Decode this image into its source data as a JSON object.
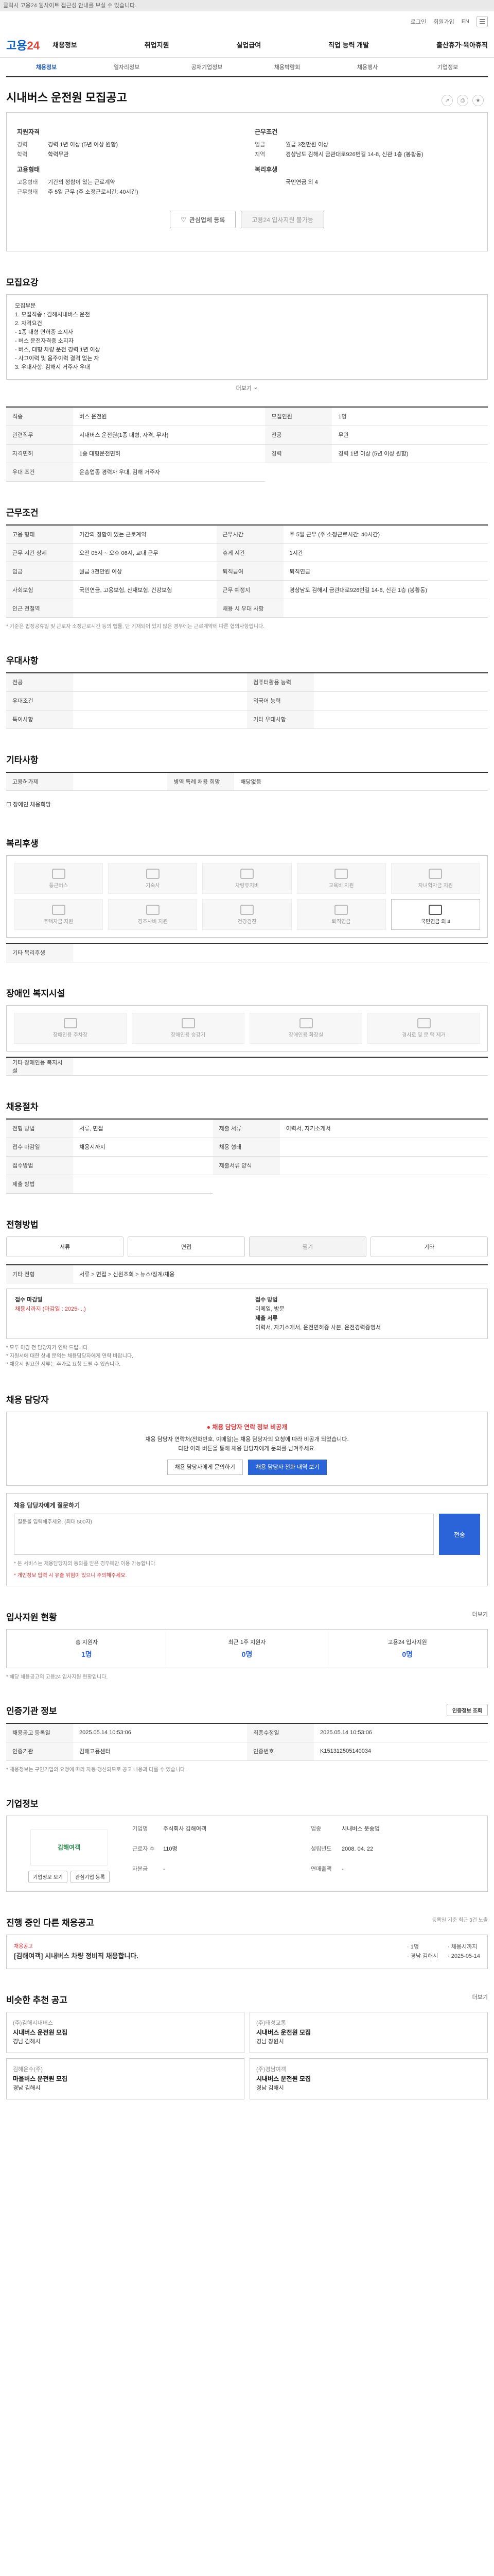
{
  "topnotice": "클릭시 고용24 웹사이트 접근성 안내를 보실 수 있습니다.",
  "util": {
    "login": "로그인",
    "join": "회원가입",
    "langs": "EN"
  },
  "logo": {
    "a": "고용",
    "b": "24"
  },
  "gnb": [
    "채용정보",
    "취업지원",
    "실업급여",
    "직업 능력 개발",
    "출산휴가·육아휴직"
  ],
  "subnav": [
    "채용정보",
    "일자리정보",
    "공채기업정보",
    "채용박람회",
    "채용행사",
    "기업정보"
  ],
  "title": "시내버스 운전원 모집공고",
  "summary": {
    "left_title": "지원자격",
    "left": [
      [
        "경력",
        "경력 1년 이상 (5년 이상 원함)"
      ],
      [
        "학력",
        "학력무관"
      ]
    ],
    "left2_title": "고용형태",
    "left2": [
      [
        "고용형태",
        "기간의 정함이 있는 근로계약"
      ],
      [
        "근무형태",
        "주 5일 근무 (주 소정근로시간: 40시간)"
      ]
    ],
    "right_title": "근무조건",
    "right": [
      [
        "임금",
        "월급 3천만원 이상"
      ],
      [
        "지역",
        "경상남도 김해시 금관대로926번길 14-8, 신관 1층 (봉황동)"
      ]
    ],
    "right2_title": "복리후생",
    "right2": [
      [
        "",
        "국민연금 외 4"
      ]
    ],
    "btn1": "관심업체 등록",
    "btn2": "고용24 입사지원 불가능"
  },
  "duty": {
    "h": "모집요강",
    "txt": "모집부문\n1. 모집직종 : 김해시내버스 운전\n2. 자격요건\n - 1종 대형 면허증 소지자\n - 버스 운전자격증 소지자\n - 버스, 대형 차량 운전 경력 1년 이상\n - 사고이력 및 음주이력 결격 없는 자\n3. 우대사항: 김해시 거주자 우대",
    "more": "더보기"
  },
  "apply": {
    "rows": [
      [
        "직종",
        "버스 운전원"
      ],
      [
        "모집인원",
        "1명"
      ],
      [
        "관련직무",
        "시내버스 운전원(1종 대형, 자격, 무사)"
      ],
      [
        "전공",
        "무관"
      ],
      [
        "자격면허",
        "1종 대형운전면허"
      ],
      [
        "경력",
        "경력 1년 이상 (5년 이상 원함)"
      ],
      [
        "우대 조건",
        "운송업종 경력자 우대, 김해 거주자"
      ]
    ],
    "right_labels": [
      "모집 직종 코드",
      "학력",
      "우대자격",
      "외국어"
    ],
    "right_values": [
      "",
      "학력무관",
      "",
      ""
    ]
  },
  "work": {
    "h": "근무조건",
    "rows": [
      [
        "고용 형태",
        "기간의 정함이 있는 근로계약"
      ],
      [
        "근무시간",
        "주 5일 근무 (주 소정근로시간: 40시간)"
      ],
      [
        "근무 시간 상세",
        "오전 05시 ~ 오후 06시, 교대 근무"
      ],
      [
        "휴게 시간",
        "1시간"
      ],
      [
        "임금",
        "월급 3천만원 이상"
      ],
      [
        "퇴직급여",
        "퇴직연금"
      ],
      [
        "사회보험",
        "국민연금, 고용보험, 산재보험, 건강보험"
      ],
      [
        "근무 예정지",
        "경상남도 김해시 금관대로926번길 14-8, 신관 1층 (봉황동)"
      ],
      [
        "인근 전철역",
        ""
      ],
      [
        "채용 시 우대 사항",
        ""
      ]
    ],
    "map": "지도 보기",
    "note": "* 기준은 법정공휴일 및 근로자 소정근로시간 등의 법률, 단 기재되어 있지 않은 경우에는 근로계약에 따른 협의사항입니다."
  },
  "preference": {
    "h": "우대사항",
    "rows": [
      [
        "전공",
        ""
      ],
      [
        "컴퓨터활용 능력",
        ""
      ],
      [
        "우대조건",
        ""
      ],
      [
        "외국어 능력",
        ""
      ],
      [
        "특이사항",
        ""
      ],
      [
        "기타 우대사항",
        ""
      ]
    ]
  },
  "other": {
    "h": "기타사항",
    "rows": [
      [
        "고용허가제",
        ""
      ],
      [
        "병역 특례 채용 희망",
        "해당없음"
      ]
    ],
    "check": "장애인 채용희망"
  },
  "welfare": {
    "h": "복리후생",
    "items": [
      "통근버스",
      "기숙사",
      "차량유지비",
      "교육비 지원",
      "자녀학자금 지원",
      "주택자금 지원",
      "경조사비 지원",
      "건강검진",
      "퇴직연금",
      "국민연금 외 4"
    ],
    "etc_label": "기타 복리후생"
  },
  "disability": {
    "h": "장애인 복지시설",
    "items": [
      "장애인용 주차장",
      "장애인용 승강기",
      "장애인용 화장실",
      "경사로 및 문 턱 제거"
    ],
    "etc_label": "기타 장애인용 복지시설"
  },
  "screen": {
    "h": "채용절차",
    "rows": [
      [
        "전형 방법",
        "서류, 면접"
      ],
      [
        "제출 서류",
        "이력서, 자기소개서"
      ],
      [
        "접수 마감일",
        "채용시까지"
      ],
      [
        "채용 형태",
        ""
      ]
    ],
    "right": [
      [
        "접수방법",
        ""
      ],
      [
        "제출서류 양식",
        ""
      ],
      [
        "제출 방법",
        ""
      ]
    ]
  },
  "method": {
    "h": "전형방법",
    "tabs": [
      "서류",
      "면접",
      "필기",
      "기타"
    ],
    "info_label": "기타 전형",
    "info_val": "서류 > 면접 > 신원조회 > 뉴스/징계/채용"
  },
  "deadline": {
    "l_title": "접수 마감일",
    "l_val": "채용시까지 (마감일 : 2025-...)",
    "r_title": "접수 방법",
    "r_val": "이메일, 방문",
    "r2_title": "제출 서류",
    "r2_val": "이력서, 자기소개서, 운전면허증 사본, 운전경력증명서",
    "bullets": "* 모두 마감 전 담당자가 연락 드립니다.\n* 지원서에 대한 상세 문의는 채용담당자에게 연락 바랍니다.\n* 채용시 필요한 서류는 추가로 요청 드릴 수 있습니다."
  },
  "contact": {
    "h": "채용 담당자",
    "warn": "채용 담당자 연락 정보 비공개",
    "text": "채용 담당자 연락처(전화번호, 이메일)는 채용 담당자의 요청에 따라 비공개 되었습니다.\n다만 아래 버튼을 통해 채용 담당자에게 문의를 남겨주세요.",
    "b1": "채용 담당자에게 문의하기",
    "b2": "채용 담당자 전화 내역 보기"
  },
  "qna": {
    "title": "채용 담당자에게 질문하기",
    "placeholder": "질문을 입력해주세요. (최대 500자)",
    "send": "전송",
    "notice1": "* 본 서비스는 채용담당자의 동의를 받은 경우에만 이용 가능합니다.",
    "notice2": "* 개인정보 입력 시 유출 위험이 있으니 주의해주세요."
  },
  "stats": {
    "h": "입사지원 현황",
    "link": "더보기",
    "items": [
      [
        "총 지원자",
        "1명"
      ],
      [
        "최근 1주 지원자",
        "0명"
      ],
      [
        "고용24 입사지원",
        "0명"
      ]
    ],
    "note": "* 해당 채용공고의 고용24 입사지원 현황입니다."
  },
  "regi": {
    "h": "인증기관 정보",
    "btn": "인증정보 조회",
    "rows": [
      [
        "채용공고 등록일",
        "2025.05.14 10:53:06"
      ],
      [
        "최종수정일",
        "2025.05.14 10:53:06"
      ],
      [
        "인증기관",
        "김해고용센터"
      ],
      [
        "인증번호",
        "K151312505140034"
      ]
    ],
    "note": "* 채용정보는 구인기업의 요청에 따라 자동 갱신되므로 공고 내용과 다를 수 있습니다."
  },
  "company": {
    "h": "기업정보",
    "logo": "김해여객",
    "btn1": "기업정보 보기",
    "btn2": "관심기업 등록",
    "rows": [
      [
        "기업명",
        "주식회사 김해여객"
      ],
      [
        "업종",
        "시내버스 운송업"
      ],
      [
        "근로자 수",
        "110명"
      ],
      [
        "설립년도",
        "2008. 04. 22"
      ],
      [
        "자본금",
        "-"
      ],
      [
        "연매출액",
        "-"
      ]
    ]
  },
  "calendar": {
    "h": "진행 중인 다른 채용공고",
    "note": "등록일 기준 최근 3건 노출",
    "item_label": "채용공고",
    "item_title": "[김해여객] 시내버스 차량 정비직 채용합니다.",
    "meta": [
      "1명",
      "채용시까지",
      "경남 김해시",
      "2025-05-14"
    ]
  },
  "recommend": {
    "h": "비슷한 추천 공고",
    "link": "더보기",
    "items": [
      {
        "co": "(주)김해시내버스",
        "title": "시내버스 운전원 모집",
        "loc": "경남 김해시"
      },
      {
        "co": "(주)태성교통",
        "title": "시내버스 운전원 모집",
        "loc": "경남 창원시"
      },
      {
        "co": "김해운수(주)",
        "title": "마을버스 운전원 모집",
        "loc": "경남 김해시"
      },
      {
        "co": "(주)경남여객",
        "title": "시내버스 운전원 모집",
        "loc": "경남 김해시"
      }
    ]
  }
}
